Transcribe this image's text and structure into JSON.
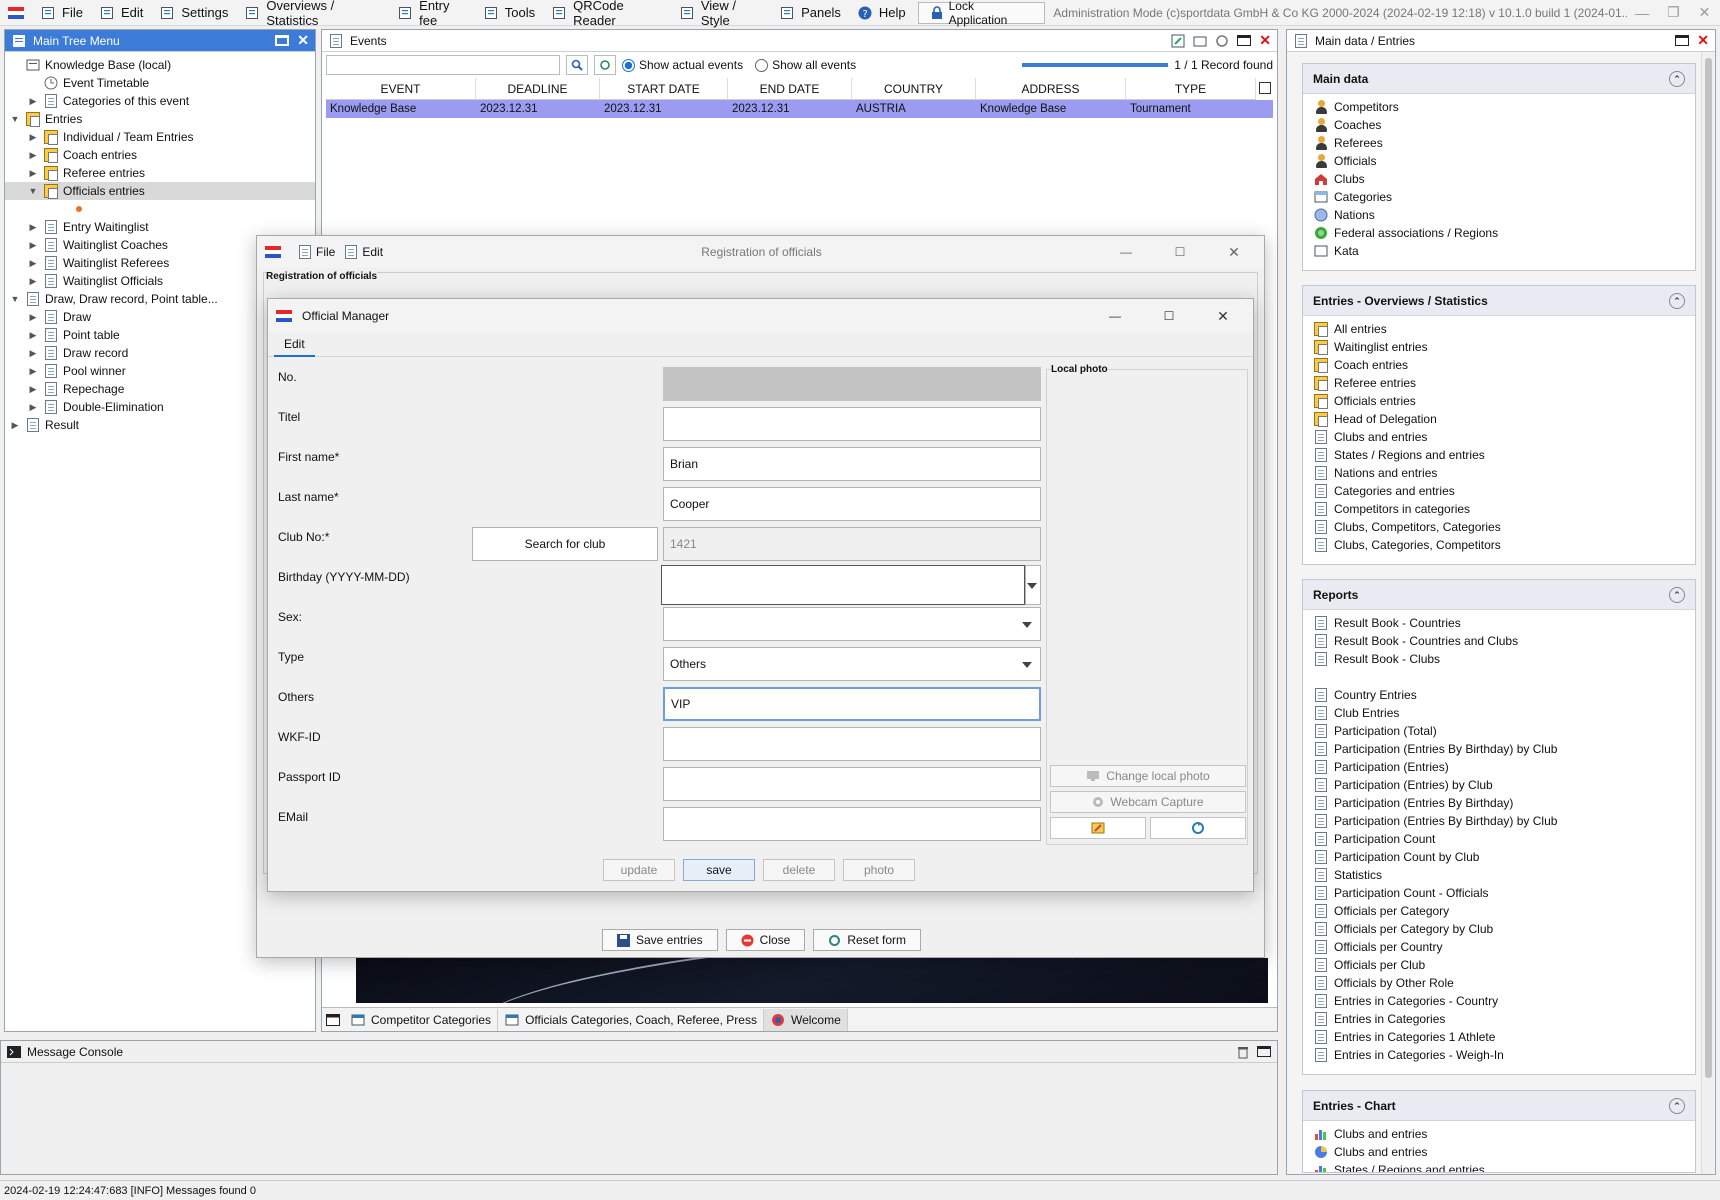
{
  "menubar": {
    "items": [
      "File",
      "Edit",
      "Settings",
      "Overviews / Statistics",
      "Entry fee",
      "Tools",
      "QRCode Reader",
      "View / Style",
      "Panels",
      "Help"
    ],
    "lock": "Lock Application",
    "title": "Administration Mode (c)sportdata GmbH & Co KG 2000-2024 (2024-02-19 12:18)  v 10.1.0 build 1 (2024-01..."
  },
  "tree": {
    "title": "Main Tree Menu",
    "items": [
      {
        "label": "Knowledge Base (local)",
        "level": 0,
        "tw": ""
      },
      {
        "label": "Event Timetable",
        "level": 1,
        "tw": ""
      },
      {
        "label": "Categories of this event",
        "level": 1,
        "tw": "▶"
      },
      {
        "label": "Entries",
        "level": 0,
        "tw": "▼"
      },
      {
        "label": "Individual / Team Entries",
        "level": 2,
        "tw": "▶"
      },
      {
        "label": "Coach entries",
        "level": 2,
        "tw": "▶"
      },
      {
        "label": "Referee entries",
        "level": 2,
        "tw": "▶"
      },
      {
        "label": "Officials entries",
        "level": 2,
        "tw": "▼"
      },
      {
        "label": "",
        "level": 3,
        "tw": ""
      },
      {
        "label": "Entry Waitinglist",
        "level": 2,
        "tw": "▶"
      },
      {
        "label": "Waitinglist Coaches",
        "level": 2,
        "tw": "▶"
      },
      {
        "label": "Waitinglist Referees",
        "level": 2,
        "tw": "▶"
      },
      {
        "label": "Waitinglist Officials",
        "level": 2,
        "tw": "▶"
      },
      {
        "label": "Draw, Draw record, Point table...",
        "level": 0,
        "tw": "▼"
      },
      {
        "label": "Draw",
        "level": 2,
        "tw": "▶"
      },
      {
        "label": "Point table",
        "level": 2,
        "tw": "▶"
      },
      {
        "label": "Draw record",
        "level": 2,
        "tw": "▶"
      },
      {
        "label": "Pool winner",
        "level": 2,
        "tw": "▶"
      },
      {
        "label": "Repechage",
        "level": 2,
        "tw": "▶"
      },
      {
        "label": "Double-Elimination",
        "level": 2,
        "tw": "▶"
      },
      {
        "label": "Result",
        "level": 0,
        "tw": "▶"
      }
    ]
  },
  "events": {
    "title": "Events",
    "show_actual": "Show actual events",
    "show_all": "Show all events",
    "found": "1 / 1 Record found",
    "columns": [
      "EVENT",
      "DEADLINE",
      "START DATE",
      "END DATE",
      "COUNTRY",
      "ADDRESS",
      "TYPE"
    ],
    "row": [
      "Knowledge Base",
      "2023.12.31",
      "2023.12.31",
      "2023.12.31",
      "AUSTRIA",
      "Knowledge Base",
      "Tournament"
    ]
  },
  "bottom_tabs": [
    "Competitor Categories",
    "Officials Categories, Coach, Referee, Press",
    "Welcome"
  ],
  "console": {
    "title": "Message Console"
  },
  "status": "2024-02-19 12:24:47:683 [INFO] Messages found 0",
  "reg": {
    "menu_file": "File",
    "menu_edit": "Edit",
    "title": "Registration of officials",
    "group": "Registration of officials",
    "save_entries": "Save entries",
    "close": "Close",
    "reset": "Reset form"
  },
  "om": {
    "title": "Official Manager",
    "tab": "Edit",
    "local_photo": "Local photo",
    "fields": {
      "no": "No.",
      "titel": "Titel",
      "first": "First name*",
      "last": "Last name*",
      "club": "Club No:*",
      "birthday": "Birthday (YYYY-MM-DD)",
      "sex": "Sex:",
      "type": "Type",
      "others": "Others",
      "wkf": "WKF-ID",
      "passport": "Passport ID",
      "email": "EMail"
    },
    "values": {
      "first": "Brian",
      "last": "Cooper",
      "club": "1421",
      "type": "Others",
      "others": "VIP"
    },
    "search_club": "Search for club",
    "change_photo": "Change local photo",
    "webcam": "Webcam Capture",
    "btn_update": "update",
    "btn_save": "save",
    "btn_delete": "delete",
    "btn_photo": "photo"
  },
  "right": {
    "title": "Main data / Entries",
    "main_data": {
      "title": "Main data",
      "items": [
        "Competitors",
        "Coaches",
        "Referees",
        "Officials",
        "Clubs",
        "Categories",
        "Nations",
        "Federal associations / Regions",
        "Kata"
      ]
    },
    "overviews": {
      "title": "Entries - Overviews / Statistics",
      "items": [
        "All entries",
        "Waitinglist entries",
        "Coach entries",
        "Referee entries",
        "Officials entries",
        "Head of Delegation",
        "Clubs and entries",
        "States / Regions and entries",
        "Nations and entries",
        "Categories and entries",
        "Competitors in categories",
        "Clubs, Competitors, Categories",
        "Clubs, Categories, Competitors"
      ]
    },
    "reports": {
      "title": "Reports",
      "items1": [
        "Result Book - Countries",
        "Result Book - Countries and Clubs",
        "Result Book - Clubs"
      ],
      "items2": [
        "Country Entries",
        "Club Entries",
        "Participation (Total)",
        "Participation (Entries By Birthday) by Club",
        "Participation (Entries)",
        "Participation (Entries) by Club",
        "Participation (Entries By Birthday)",
        "Participation (Entries By Birthday) by Club",
        "Participation Count",
        "Participation Count by Club",
        "Statistics",
        "Participation Count - Officials",
        "Officials per Category",
        "Officials per Category by Club",
        "Officials per Country",
        "Officials per Club",
        "Officials by Other Role",
        "Entries in Categories - Country",
        "Entries in Categories",
        "Entries in Categories 1 Athlete",
        "Entries in Categories - Weigh-In"
      ]
    },
    "chart": {
      "title": "Entries - Chart",
      "items": [
        "Clubs and entries",
        "Clubs and entries",
        "States / Regions and entries"
      ]
    }
  }
}
